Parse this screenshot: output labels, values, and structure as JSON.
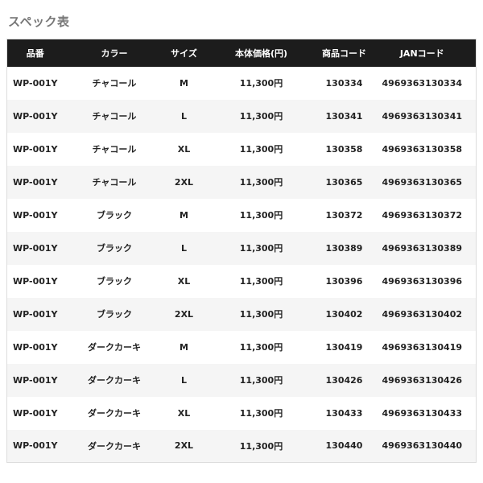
{
  "page": {
    "title": "スペック表"
  },
  "table": {
    "headers": [
      "品番",
      "カラー",
      "サイズ",
      "本体価格(円)",
      "商品コード",
      "JANコード"
    ],
    "rows": [
      [
        "WP-001Y",
        "チャコール",
        "M",
        "11,300円",
        "130334",
        "4969363130334"
      ],
      [
        "WP-001Y",
        "チャコール",
        "L",
        "11,300円",
        "130341",
        "4969363130341"
      ],
      [
        "WP-001Y",
        "チャコール",
        "XL",
        "11,300円",
        "130358",
        "4969363130358"
      ],
      [
        "WP-001Y",
        "チャコール",
        "2XL",
        "11,300円",
        "130365",
        "4969363130365"
      ],
      [
        "WP-001Y",
        "ブラック",
        "M",
        "11,300円",
        "130372",
        "4969363130372"
      ],
      [
        "WP-001Y",
        "ブラック",
        "L",
        "11,300円",
        "130389",
        "4969363130389"
      ],
      [
        "WP-001Y",
        "ブラック",
        "XL",
        "11,300円",
        "130396",
        "4969363130396"
      ],
      [
        "WP-001Y",
        "ブラック",
        "2XL",
        "11,300円",
        "130402",
        "4969363130402"
      ],
      [
        "WP-001Y",
        "ダークカーキ",
        "M",
        "11,300円",
        "130419",
        "4969363130419"
      ],
      [
        "WP-001Y",
        "ダークカーキ",
        "L",
        "11,300円",
        "130426",
        "4969363130426"
      ],
      [
        "WP-001Y",
        "ダークカーキ",
        "XL",
        "11,300円",
        "130433",
        "4969363130433"
      ],
      [
        "WP-001Y",
        "ダークカーキ",
        "2XL",
        "11,300円",
        "130440",
        "4969363130440"
      ]
    ]
  },
  "colors": {
    "header_bg": "#1c1c1c",
    "header_text": "#ffffff",
    "row_alt_bg": "#f5f5f5",
    "title_text": "#777777"
  }
}
